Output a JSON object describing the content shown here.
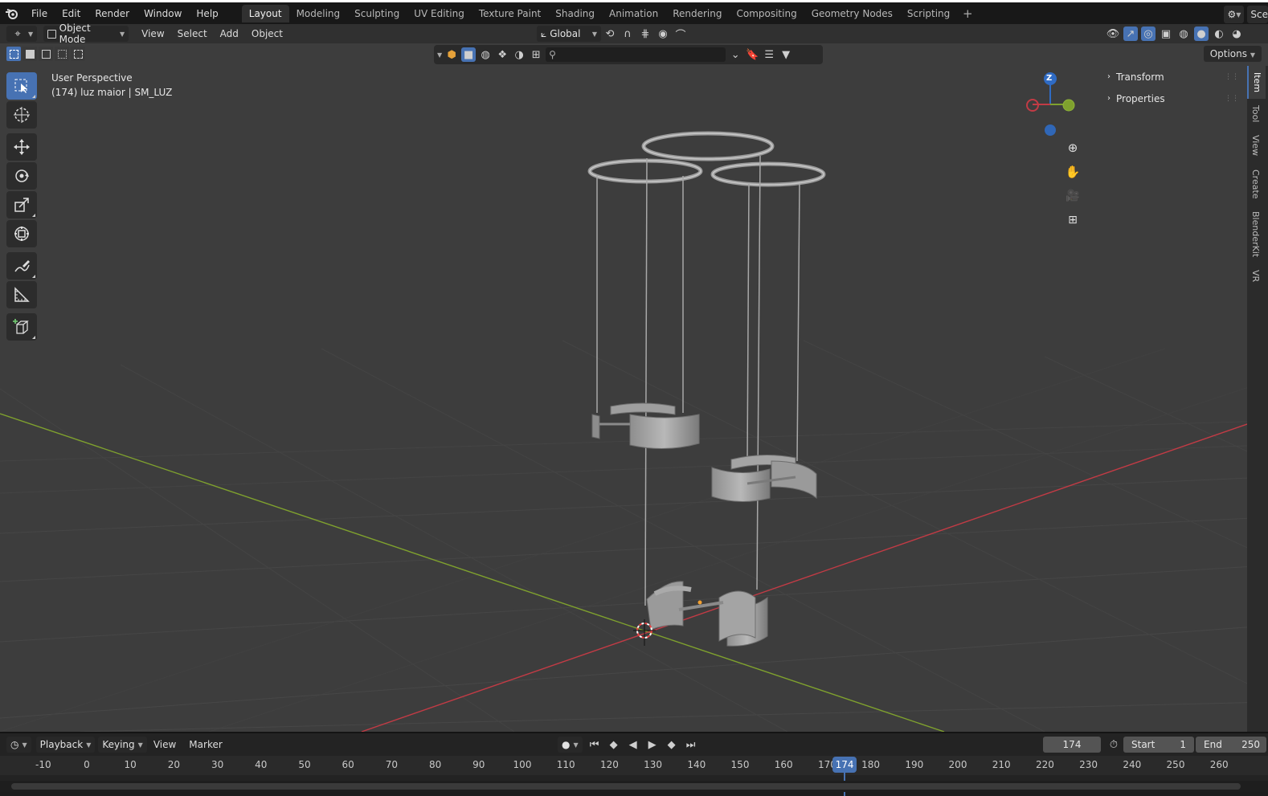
{
  "top_menu": [
    "File",
    "Edit",
    "Render",
    "Window",
    "Help"
  ],
  "workspace_tabs": [
    "Layout",
    "Modeling",
    "Sculpting",
    "UV Editing",
    "Texture Paint",
    "Shading",
    "Animation",
    "Rendering",
    "Compositing",
    "Geometry Nodes",
    "Scripting"
  ],
  "active_workspace": "Layout",
  "scene_label": "Sce",
  "header": {
    "mode": "Object Mode",
    "menus": [
      "View",
      "Select",
      "Add",
      "Object"
    ],
    "transform_orientation": "Global"
  },
  "viewport": {
    "perspective_label": "User Perspective",
    "object_label": "(174) luz maior | SM_LUZ",
    "options_label": "Options",
    "gizmo_axis_label": "Z"
  },
  "sidebar": {
    "panels": [
      "Transform",
      "Properties"
    ],
    "tabs": [
      "Item",
      "Tool",
      "View",
      "Create",
      "BlenderKit",
      "VR"
    ]
  },
  "timeline": {
    "menus": [
      "Playback",
      "Keying",
      "View",
      "Marker"
    ],
    "current_frame": "174",
    "start_label": "Start",
    "start_value": "1",
    "end_label": "End",
    "end_value": "250",
    "ticks": [
      "-10",
      "0",
      "10",
      "20",
      "30",
      "40",
      "50",
      "60",
      "70",
      "80",
      "90",
      "100",
      "110",
      "120",
      "130",
      "140",
      "150",
      "160",
      "170",
      "180",
      "190",
      "200",
      "210",
      "220",
      "230",
      "240",
      "250",
      "260"
    ],
    "playhead_label": "174"
  },
  "colors": {
    "accent": "#4772b3",
    "x_axis": "#c23b45",
    "y_axis": "#7fa12e",
    "z_axis": "#2f6bc4"
  }
}
